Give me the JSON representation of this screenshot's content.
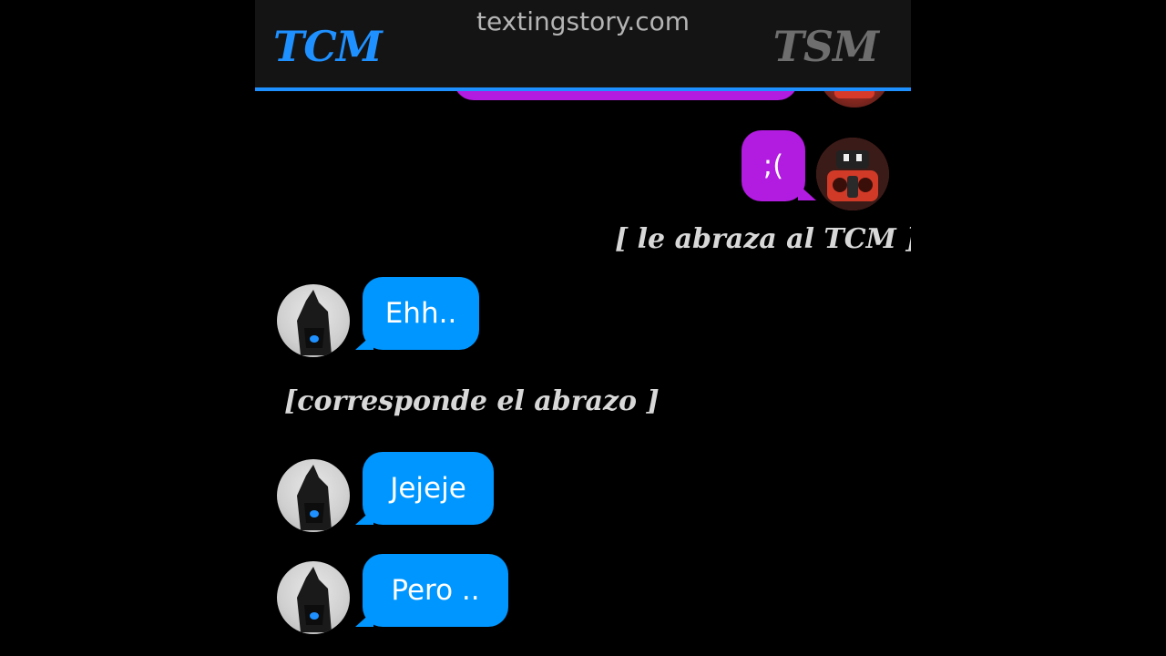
{
  "header": {
    "watermark": "textingstory.com",
    "left_contact": "TCM",
    "right_contact": "TSM",
    "accent_color": "#1e90ff"
  },
  "messages": [
    {
      "side": "out",
      "text": "",
      "partial": true
    },
    {
      "side": "out",
      "text": ";("
    },
    {
      "type": "action",
      "text": "[ le abraza al TCM ]"
    },
    {
      "side": "in",
      "text": "Ehh.."
    },
    {
      "type": "action",
      "text": "[corresponde el abrazo ]"
    },
    {
      "side": "in",
      "text": "Jejeje"
    },
    {
      "side": "in",
      "text": "Pero .."
    }
  ],
  "colors": {
    "incoming_bubble": "#0096ff",
    "outgoing_bubble": "#b21be0",
    "background": "#000000"
  },
  "icons": {
    "tcm_avatar": "dark-wolf-avatar",
    "tsm_avatar": "red-robot-avatar"
  }
}
